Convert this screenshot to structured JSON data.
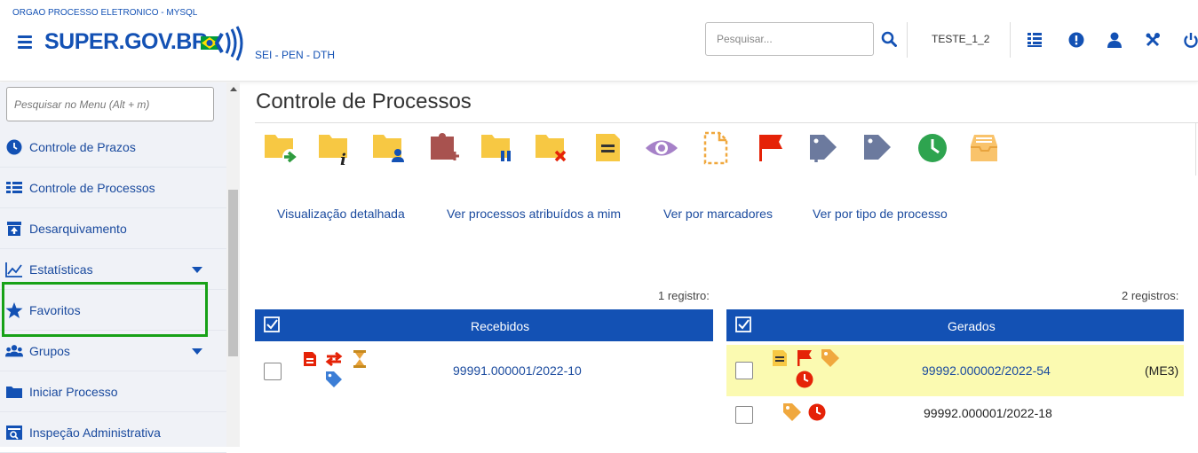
{
  "header": {
    "org": "ORGAO PROCESSO ELETRONICO - MYSQL",
    "brand": "SUPER.GOV.BR",
    "subtitle": "SEI - PEN - DTH",
    "search_placeholder": "Pesquisar...",
    "user": "TESTE_1_2",
    "icons": [
      "menu-icon",
      "search-icon",
      "units-list-icon",
      "info-alert-icon",
      "user-icon",
      "tools-icon",
      "power-icon"
    ]
  },
  "sidebar": {
    "search_placeholder": "Pesquisar no Menu (Alt + m)",
    "items": [
      {
        "label": "Controle de Prazos",
        "icon": "clock-icon"
      },
      {
        "label": "Controle de Processos",
        "icon": "list-icon"
      },
      {
        "label": "Desarquivamento",
        "icon": "unarchive-icon"
      },
      {
        "label": "Estatísticas",
        "icon": "chart-icon",
        "expandable": true
      },
      {
        "label": "Favoritos",
        "icon": "star-icon"
      },
      {
        "label": "Grupos",
        "icon": "group-icon",
        "expandable": true
      },
      {
        "label": "Iniciar Processo",
        "icon": "folder-icon"
      },
      {
        "label": "Inspeção Administrativa",
        "icon": "inspection-icon"
      }
    ],
    "highlight_color": "#17a117"
  },
  "main": {
    "title": "Controle de Processos",
    "toolbar": [
      "send-process-icon",
      "process-info-icon",
      "assign-process-icon",
      "attach-process-icon",
      "suspend-process-icon",
      "conclude-process-icon",
      "note-icon",
      "view-icon",
      "new-document-icon",
      "flag-icon",
      "add-marker-icon",
      "remove-marker-icon",
      "deadline-icon",
      "archive-icon"
    ],
    "views": [
      "Visualização detalhada",
      "Ver processos atribuídos a mim",
      "Ver por marcadores",
      "Ver por tipo de processo"
    ]
  },
  "tables": {
    "received": {
      "count": "1 registro:",
      "title": "Recebidos",
      "rows": [
        {
          "process": "99991.000001/2022-10",
          "icons": [
            "document-red-icon",
            "transfer-icon",
            "hourglass-icon",
            "tag-blue-icon"
          ]
        }
      ]
    },
    "generated": {
      "count": "2 registros:",
      "title": "Gerados",
      "rows": [
        {
          "process": "99992.000002/2022-54",
          "extra": "(ME3)",
          "highlighted": true,
          "icons": [
            "note-yellow-icon",
            "flag-red-icon",
            "tag-orange-icon",
            "clock-red-icon"
          ]
        },
        {
          "process": "99992.000001/2022-18",
          "extra": "",
          "highlighted": false,
          "icons": [
            "tag-orange-icon",
            "clock-red-icon"
          ]
        }
      ]
    }
  },
  "colors": {
    "brand_blue": "#1351b4",
    "row_highlight": "#fbfab1",
    "folder_yellow": "#f7c843",
    "alert_red": "#e52207"
  }
}
